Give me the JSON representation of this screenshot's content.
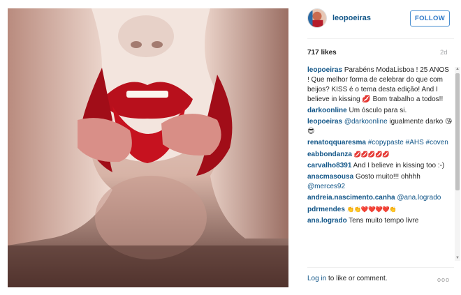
{
  "post": {
    "username": "leopoeiras",
    "follow_label": "FOLLOW",
    "likes": "717 likes",
    "time": "2d"
  },
  "comments": [
    {
      "user": "leopoeiras",
      "text": "Parabéns ModaLisboa ! 25 ANOS ! Que melhor forma de celebrar do que com beijos? KISS é o tema desta edição! And I believe in kissing 💋 Bom trabalho a todos!!"
    },
    {
      "user": "darkoonline",
      "text": "Um ósculo para si."
    },
    {
      "user": "leopoeiras",
      "mention": "@darkoonline",
      "text": "igualmente darko 😘😎"
    },
    {
      "user": "renatoqquaresma",
      "mention": "#copypaste #AHS #coven",
      "text": ""
    },
    {
      "user": "eabbondanza",
      "text": "💋💋💋💋💋"
    },
    {
      "user": "carvalho8391",
      "text": "And I believe in kissing too :-)"
    },
    {
      "user": "anacmasousa",
      "text": "Gosto muito!!! ohhhh",
      "mention2": "@merces92"
    },
    {
      "user": "andreia.nascimento.canha",
      "mention": "@ana.logrado",
      "text": ""
    },
    {
      "user": "pdrmendes",
      "text": "👏👏❤️❤️❤️❤️👏"
    },
    {
      "user": "ana.logrado",
      "text": "Tens muito tempo livre"
    }
  ],
  "footer": {
    "login_label": "Log in",
    "suffix": " to like or comment.",
    "more_label": "ooo"
  },
  "icons": {
    "avatar": "profile-avatar",
    "more": "more-options-icon",
    "scroll_up": "scroll-up-arrow",
    "scroll_down": "scroll-down-arrow"
  }
}
